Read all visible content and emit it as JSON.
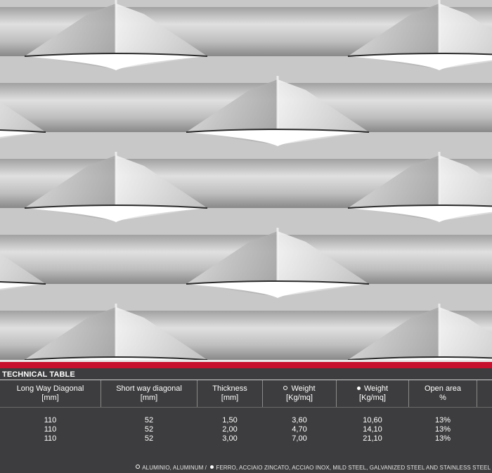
{
  "technical_table": {
    "title": "TECHNICAL TABLE",
    "columns": [
      {
        "label": "Long Way Diagonal",
        "unit": "[mm]",
        "marker": ""
      },
      {
        "label": "Short way diagonal",
        "unit": "[mm]",
        "marker": ""
      },
      {
        "label": "Thickness",
        "unit": "[mm]",
        "marker": ""
      },
      {
        "label": "Weight",
        "unit": "[Kg/mq]",
        "marker": "hollow"
      },
      {
        "label": "Weight",
        "unit": "[Kg/mq]",
        "marker": "solid"
      },
      {
        "label": "Open area",
        "unit": "%",
        "marker": ""
      }
    ],
    "rows": [
      [
        "110",
        "52",
        "1,50",
        "3,60",
        "10,60",
        "13%"
      ],
      [
        "110",
        "52",
        "2,00",
        "4,70",
        "14,10",
        "13%"
      ],
      [
        "110",
        "52",
        "3,00",
        "7,00",
        "21,10",
        "13%"
      ]
    ]
  },
  "legend": {
    "hollow_text": "ALUMINIO, ALUMINUM /",
    "solid_text": "FERRO, ACCIAIO ZINCATO, ACCIAO INOX, MILD STEEL, GALVANIZED STEEL AND STAINLESS STEEL"
  },
  "colors": {
    "panel": "#3d3d3f",
    "accent_red": "#c7102e"
  }
}
